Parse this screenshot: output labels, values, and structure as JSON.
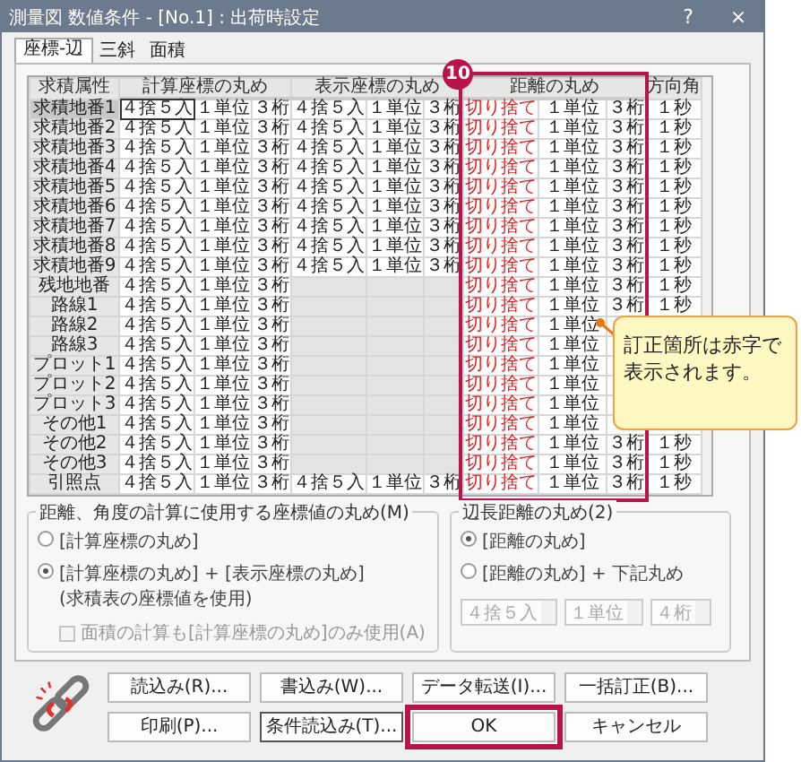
{
  "window": {
    "title": "測量図 数値条件 - [No.1] : 出荷時設定",
    "help": "?",
    "close": "×"
  },
  "tabs": [
    {
      "label": "座標-辺",
      "selected": true
    },
    {
      "label": "三斜",
      "selected": false
    },
    {
      "label": "面積",
      "selected": false
    }
  ],
  "table": {
    "header": {
      "attribute": "求積属性",
      "calc": "計算座標の丸め",
      "display": "表示座標の丸め",
      "distance": "距離の丸め",
      "angle": "方向角"
    },
    "rows": [
      {
        "label": "求積地番1",
        "selected": true,
        "calc": [
          "４捨５入",
          "１単位",
          "３桁"
        ],
        "display": [
          "４捨５入",
          "１単位",
          "３桁"
        ],
        "distance": [
          "切り捨て",
          "１単位",
          "３桁"
        ],
        "distance_corrected": true,
        "angle": "１秒"
      },
      {
        "label": "求積地番2",
        "selected": false,
        "calc": [
          "４捨５入",
          "１単位",
          "３桁"
        ],
        "display": [
          "４捨５入",
          "１単位",
          "３桁"
        ],
        "distance": [
          "切り捨て",
          "１単位",
          "３桁"
        ],
        "distance_corrected": true,
        "angle": "１秒"
      },
      {
        "label": "求積地番3",
        "selected": false,
        "calc": [
          "４捨５入",
          "１単位",
          "３桁"
        ],
        "display": [
          "４捨５入",
          "１単位",
          "３桁"
        ],
        "distance": [
          "切り捨て",
          "１単位",
          "３桁"
        ],
        "distance_corrected": true,
        "angle": "１秒"
      },
      {
        "label": "求積地番4",
        "selected": false,
        "calc": [
          "４捨５入",
          "１単位",
          "３桁"
        ],
        "display": [
          "４捨５入",
          "１単位",
          "３桁"
        ],
        "distance": [
          "切り捨て",
          "１単位",
          "３桁"
        ],
        "distance_corrected": true,
        "angle": "１秒"
      },
      {
        "label": "求積地番5",
        "selected": false,
        "calc": [
          "４捨５入",
          "１単位",
          "３桁"
        ],
        "display": [
          "４捨５入",
          "１単位",
          "３桁"
        ],
        "distance": [
          "切り捨て",
          "１単位",
          "３桁"
        ],
        "distance_corrected": true,
        "angle": "１秒"
      },
      {
        "label": "求積地番6",
        "selected": false,
        "calc": [
          "４捨５入",
          "１単位",
          "３桁"
        ],
        "display": [
          "４捨５入",
          "１単位",
          "３桁"
        ],
        "distance": [
          "切り捨て",
          "１単位",
          "３桁"
        ],
        "distance_corrected": true,
        "angle": "１秒"
      },
      {
        "label": "求積地番7",
        "selected": false,
        "calc": [
          "４捨５入",
          "１単位",
          "３桁"
        ],
        "display": [
          "４捨５入",
          "１単位",
          "３桁"
        ],
        "distance": [
          "切り捨て",
          "１単位",
          "３桁"
        ],
        "distance_corrected": true,
        "angle": "１秒"
      },
      {
        "label": "求積地番8",
        "selected": false,
        "calc": [
          "４捨５入",
          "１単位",
          "３桁"
        ],
        "display": [
          "４捨５入",
          "１単位",
          "３桁"
        ],
        "distance": [
          "切り捨て",
          "１単位",
          "３桁"
        ],
        "distance_corrected": true,
        "angle": "１秒"
      },
      {
        "label": "求積地番9",
        "selected": false,
        "calc": [
          "４捨５入",
          "１単位",
          "３桁"
        ],
        "display": [
          "４捨５入",
          "１単位",
          "３桁"
        ],
        "distance": [
          "切り捨て",
          "１単位",
          "３桁"
        ],
        "distance_corrected": true,
        "angle": "１秒"
      },
      {
        "label": "残地地番",
        "selected": false,
        "calc": [
          "４捨５入",
          "１単位",
          "３桁"
        ],
        "distance": [
          "切り捨て",
          "１単位",
          "３桁"
        ],
        "distance_corrected": true,
        "angle": "１秒"
      },
      {
        "label": "路線1",
        "selected": false,
        "calc": [
          "４捨５入",
          "１単位",
          "３桁"
        ],
        "distance": [
          "切り捨て",
          "１単位",
          "３桁"
        ],
        "distance_corrected": true,
        "angle": "１秒"
      },
      {
        "label": "路線2",
        "selected": false,
        "calc": [
          "４捨５入",
          "１単位",
          "３桁"
        ],
        "distance": [
          "切り捨て",
          "１単位"
        ],
        "distance_corrected": true
      },
      {
        "label": "路線3",
        "selected": false,
        "calc": [
          "４捨５入",
          "１単位",
          "３桁"
        ],
        "distance": [
          "切り捨て",
          "１単位"
        ],
        "distance_corrected": true
      },
      {
        "label": "プロット1",
        "selected": false,
        "calc": [
          "４捨５入",
          "１単位",
          "３桁"
        ],
        "distance": [
          "切り捨て",
          "１単位"
        ],
        "distance_corrected": true
      },
      {
        "label": "プロット2",
        "selected": false,
        "calc": [
          "４捨５入",
          "１単位",
          "３桁"
        ],
        "distance": [
          "切り捨て",
          "１単位"
        ],
        "distance_corrected": true
      },
      {
        "label": "プロット3",
        "selected": false,
        "calc": [
          "４捨５入",
          "１単位",
          "３桁"
        ],
        "distance": [
          "切り捨て",
          "１単位"
        ],
        "distance_corrected": true
      },
      {
        "label": "その他1",
        "selected": false,
        "calc": [
          "４捨５入",
          "１単位",
          "３桁"
        ],
        "distance": [
          "切り捨て",
          "１単位"
        ],
        "distance_corrected": true
      },
      {
        "label": "その他2",
        "selected": false,
        "calc": [
          "４捨５入",
          "１単位",
          "３桁"
        ],
        "distance": [
          "切り捨て",
          "１単位",
          "３桁"
        ],
        "distance_corrected": true,
        "angle": "１秒"
      },
      {
        "label": "その他3",
        "selected": false,
        "calc": [
          "４捨５入",
          "１単位",
          "３桁"
        ],
        "distance": [
          "切り捨て",
          "１単位",
          "３桁"
        ],
        "distance_corrected": true,
        "angle": "１秒"
      },
      {
        "label": "引照点",
        "selected": false,
        "calc": [
          "４捨５入",
          "１単位",
          "３桁"
        ],
        "display": [
          "４捨５入",
          "１単位",
          "３桁"
        ],
        "distance": [
          "切り捨て",
          "１単位",
          "３桁"
        ],
        "distance_corrected": true,
        "angle": "１秒"
      }
    ]
  },
  "marker": "10",
  "callout": "訂正箇所は赤字で表示されます。",
  "coord_group": {
    "title": "距離、角度の計算に使用する座標値の丸め(M)",
    "options": [
      {
        "lines": [
          "[計算座標の丸め]"
        ],
        "selected": false
      },
      {
        "lines": [
          "[計算座標の丸め] + [表示座標の丸め]",
          "(求積表の座標値を使用)"
        ],
        "selected": true
      }
    ],
    "checkbox": {
      "label": "面積の計算も[計算座標の丸め]のみ使用(A)",
      "checked": false,
      "disabled": true
    }
  },
  "edge_group": {
    "title": "辺長距離の丸め(2)",
    "options": [
      {
        "lines": [
          "[距離の丸め]"
        ],
        "selected": true
      },
      {
        "lines": [
          "[距離の丸め] + 下記丸め"
        ],
        "selected": false
      }
    ],
    "dropdowns": [
      {
        "value": "４捨５入",
        "disabled": true
      },
      {
        "value": "１単位",
        "disabled": true
      },
      {
        "value": "４桁",
        "disabled": true
      }
    ]
  },
  "buttons": [
    [
      {
        "label": "読込み(R)...",
        "focused": false,
        "highlighted": false
      },
      {
        "label": "書込み(W)...",
        "focused": false,
        "highlighted": false
      },
      {
        "label": "データ転送(I)...",
        "focused": false,
        "highlighted": false
      },
      {
        "label": "一括訂正(B)...",
        "focused": false,
        "highlighted": false
      }
    ],
    [
      {
        "label": "印刷(P)...",
        "focused": false,
        "highlighted": false
      },
      {
        "label": "条件読込み(T)...",
        "focused": true,
        "highlighted": false
      },
      {
        "label": "OK",
        "focused": false,
        "highlighted": true
      },
      {
        "label": "キャンセル",
        "focused": false,
        "highlighted": false
      }
    ]
  ]
}
